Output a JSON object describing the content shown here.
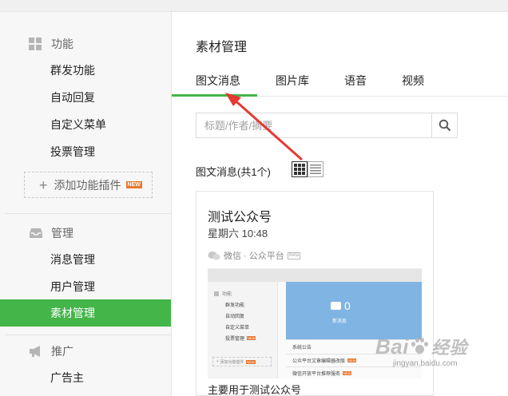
{
  "sidebar": {
    "sections": [
      {
        "heading": "功能",
        "icon": "grid-icon",
        "items": [
          {
            "label": "群发功能",
            "active": false
          },
          {
            "label": "自动回复",
            "active": false
          },
          {
            "label": "自定义菜单",
            "active": false
          },
          {
            "label": "投票管理",
            "active": false
          }
        ],
        "add_plugin": {
          "label": "添加功能插件",
          "badge": "NEW"
        }
      },
      {
        "heading": "管理",
        "icon": "inbox-icon",
        "items": [
          {
            "label": "消息管理",
            "active": false
          },
          {
            "label": "用户管理",
            "active": false
          },
          {
            "label": "素材管理",
            "active": true
          }
        ]
      },
      {
        "heading": "推广",
        "icon": "megaphone-icon",
        "items": [
          {
            "label": "广告主",
            "active": false
          }
        ]
      }
    ]
  },
  "main": {
    "title": "素材管理",
    "tabs": [
      {
        "label": "图文消息",
        "active": true
      },
      {
        "label": "图片库",
        "active": false
      },
      {
        "label": "语音",
        "active": false
      },
      {
        "label": "视频",
        "active": false
      }
    ],
    "search": {
      "placeholder": "标题/作者/摘要",
      "value": ""
    },
    "count_label": "图文消息(共1个)",
    "view_mode": "grid",
    "card": {
      "title": "测试公众号",
      "date": "星期六 10:48",
      "source": "微信 · 公众平台",
      "summary": "主要用于测试公众号",
      "thumbnail": {
        "sidebar_heading": "功能",
        "sidebar_items": [
          "群发功能",
          "自动回复",
          "自定义菜单",
          "投票管理"
        ],
        "add_plugin": "添加功能插件",
        "new_message_count": "0",
        "new_message_label": "新消息",
        "rows": [
          "系统公告",
          "公众平台文章编辑器改版",
          "微信开放平台推荐服务"
        ]
      }
    }
  },
  "watermark": {
    "logo_left": "Bai",
    "logo_right": "经验",
    "url": "jingyan.baidu.com"
  },
  "colors": {
    "accent": "#44b549",
    "arrow": "#e53935",
    "badge": "#e8782f",
    "thumb_blue": "#7fb4e3"
  }
}
